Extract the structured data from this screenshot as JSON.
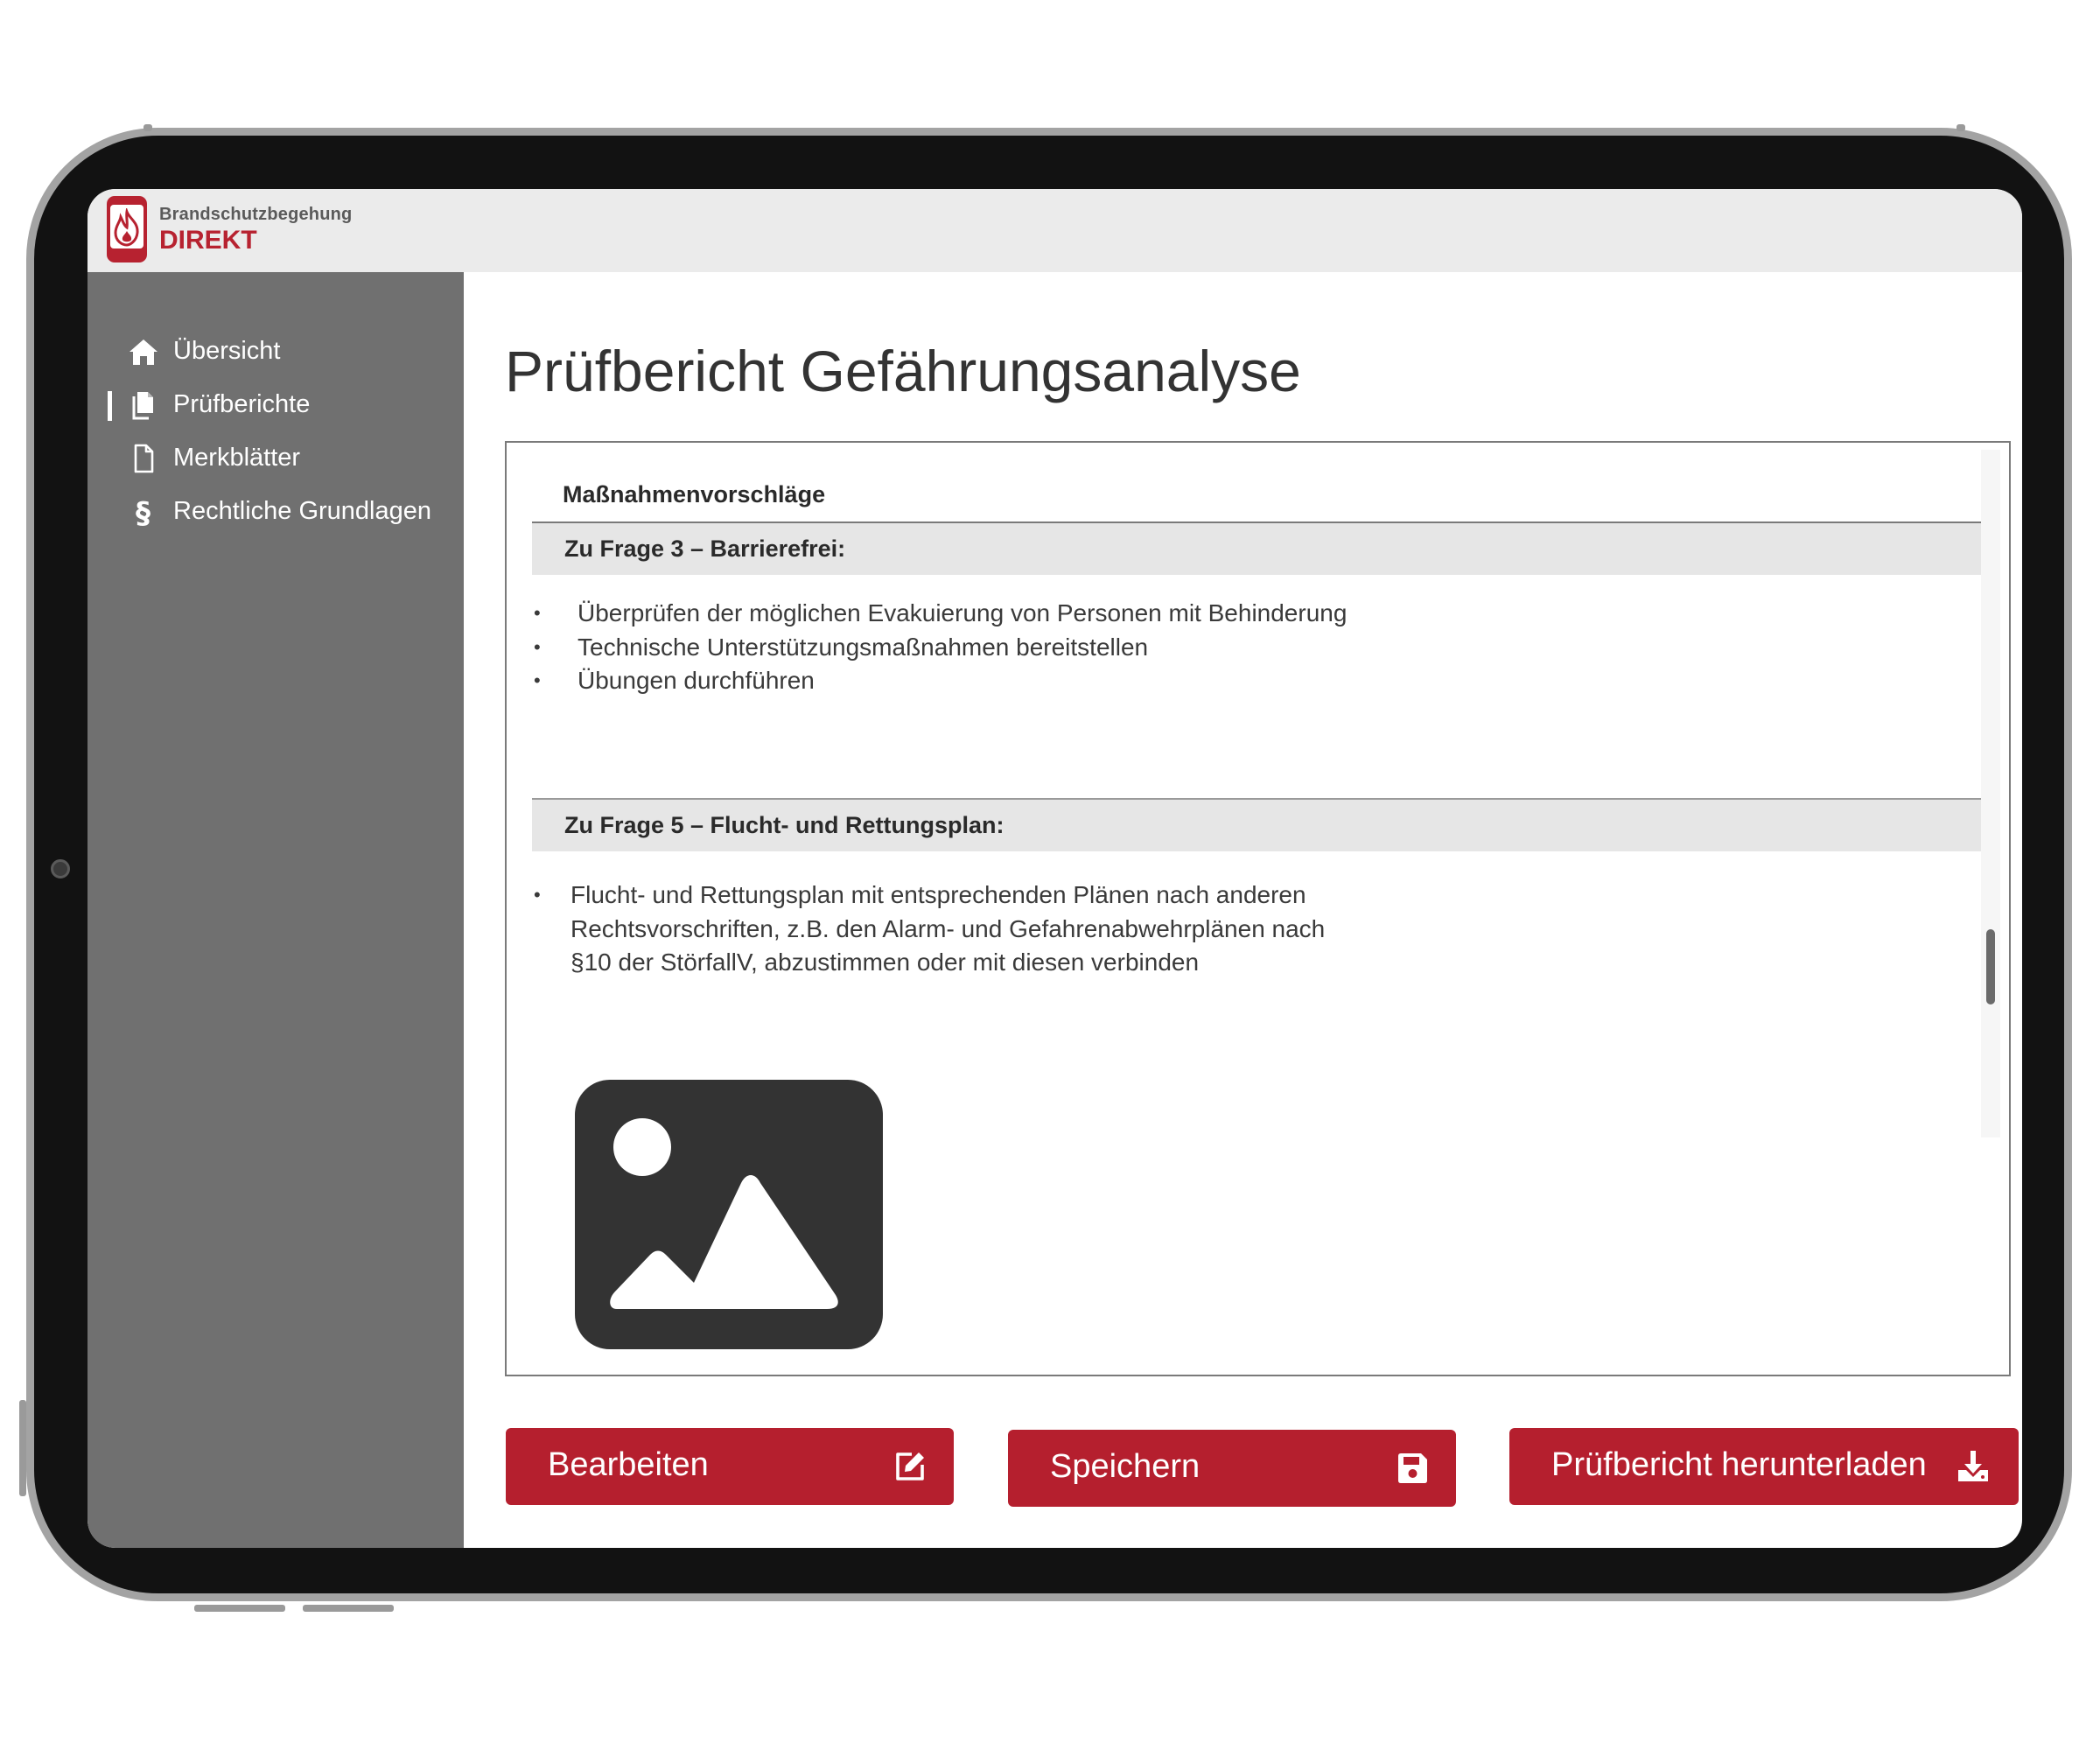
{
  "app": {
    "logo_line1": "Brandschutzbegehung",
    "logo_line2": "DIREKT",
    "brand_color": "#b72230"
  },
  "sidebar": {
    "items": [
      {
        "label": "Übersicht",
        "icon": "home-icon",
        "active": false
      },
      {
        "label": "Prüfberichte",
        "icon": "documents-icon",
        "active": true
      },
      {
        "label": "Merkblätter",
        "icon": "document-icon",
        "active": false
      },
      {
        "label": "Rechtliche Grundlagen",
        "icon": "paragraph-icon",
        "active": false
      }
    ]
  },
  "main": {
    "title": "Prüfbericht Gefährungsanalyse",
    "section_title": "Maßnahmenvorschläge",
    "questions": [
      {
        "title": "Zu Frage 3 – Barrierefrei:",
        "bullets": [
          "Überprüfen der möglichen Evakuierung von Personen mit Behinderung",
          "Technische Unterstützungsmaßnahmen bereitstellen",
          "Übungen durchführen"
        ]
      },
      {
        "title": "Zu Frage 5 – Flucht- und Rettungsplan:",
        "bullets": [
          "Flucht- und Rettungsplan mit entsprechenden Plänen nach anderen Rechtsvorschriften, z.B. den Alarm- und Gefahrenabwehrplänen nach §10 der StörfallV, abzustimmen oder mit diesen verbinden"
        ],
        "bullet_lines": [
          "Flucht- und Rettungsplan mit entsprechenden Plänen nach anderen",
          "Rechtsvorschriften, z.B. den Alarm- und Gefahrenabwehrplänen nach",
          "§10 der StörfallV, abzustimmen oder mit diesen verbinden"
        ]
      }
    ],
    "image_icon": "image-placeholder-icon"
  },
  "actions": {
    "edit_label": "Bearbeiten",
    "save_label": "Speichern",
    "download_label": "Prüfbericht herunterladen",
    "edit_icon": "edit-icon",
    "save_icon": "save-icon",
    "download_icon": "download-icon"
  }
}
